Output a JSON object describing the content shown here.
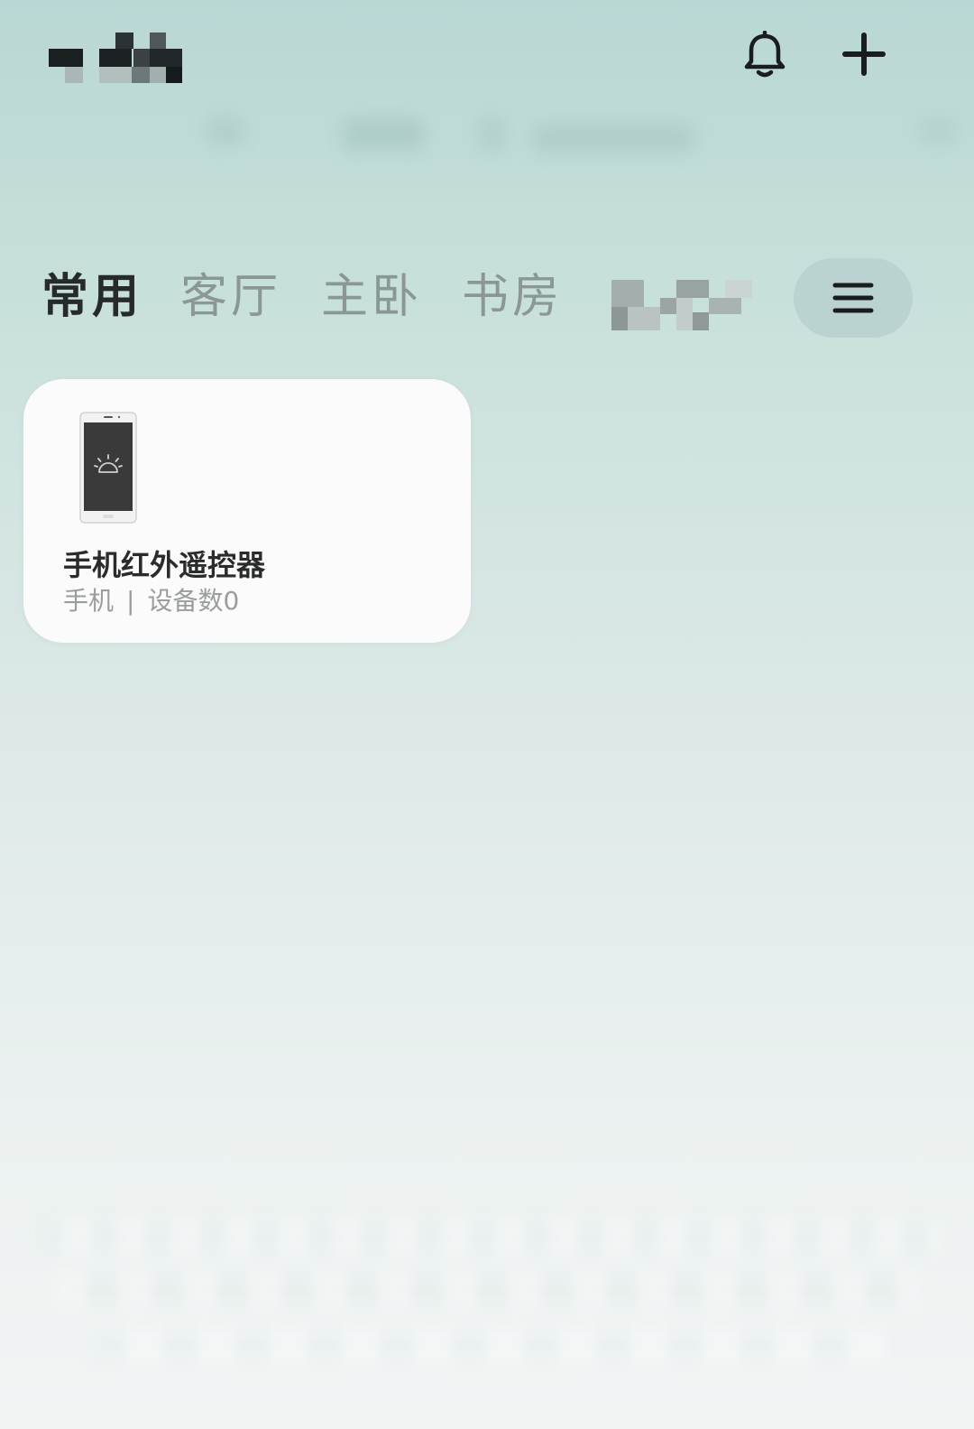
{
  "header": {
    "home_name": "",
    "icons": {
      "notification": "bell-icon",
      "add": "plus-icon"
    }
  },
  "tabs": [
    {
      "label": "常用",
      "active": true
    },
    {
      "label": "客厅",
      "active": false
    },
    {
      "label": "主卧",
      "active": false
    },
    {
      "label": "书房",
      "active": false
    }
  ],
  "tab_menu_icon": "menu-icon",
  "device_card": {
    "name": "手机红外遥控器",
    "type": "手机",
    "separator": "|",
    "count": "设备数0",
    "icon": "phone-icon"
  },
  "colors": {
    "bg_top": "#b9d7d4",
    "bg_bottom": "#f2f4f4",
    "active_tab": "#262a2a",
    "inactive_tab": "#8a9795",
    "card_bg": "#fbfbfb"
  }
}
